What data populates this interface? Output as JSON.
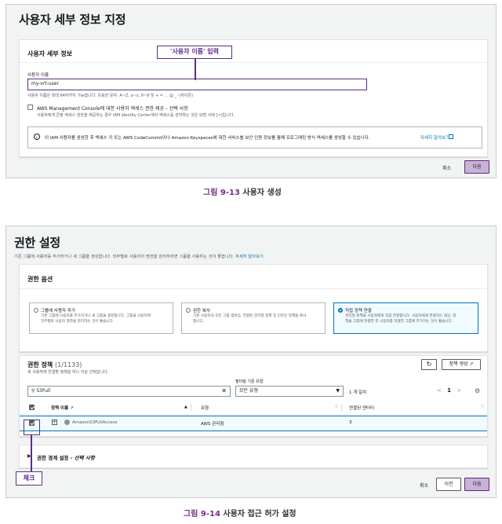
{
  "fig1": {
    "page_title": "사용자 세부 정보 지정",
    "section_title": "사용자 세부 정보",
    "callout": "'사용자 이름' 입력",
    "username_label": "사용자 이름",
    "username_value": "my-vrt-user",
    "username_hint": "사용자 이름은 최대 64자까지 가능합니다. 유효한 문자: A~Z, a~z, 0~9 및 + = , . @ _ -(하이픈)",
    "console_access_label": "AWS Management Console에 대한 사용자 액세스 권한 제공 – 선택 사항",
    "console_access_desc": "사용자에게 콘솔 액세스 권한을 제공하는 경우 IAM Identity Center에서 액세스를 관리하는 것은 모범 사례 [↗]입니다.",
    "info_text": "이 IAM 사용자를 생성한 후 액세스 키 또는 AWS CodeCommit이나 Amazon Keyspaces에 대한 서비스별 보안 인증 정보를 통해 프로그래밍 방식 액세스를 생성할 수 있습니다.",
    "info_link": "자세히 알아보기",
    "cancel": "취소",
    "next": "다음",
    "caption_num": "그림 9-13",
    "caption_text": "사용자 생성"
  },
  "fig2": {
    "page_title": "권한 설정",
    "page_desc": "기존 그룹에 사용자를 추가하거나 새 그룹을 생성합니다. 직무별로 사용자의 권한을 관리하려면 그룹을 사용하는 것이 좋습니다.",
    "page_desc_link": "자세히 알아보기",
    "options_title": "권한 옵션",
    "options": [
      {
        "title": "그룹에 사용자 추가",
        "desc": "기존 그룹에 사용자를 추가하거나 새 그룹을 생성합니다. 그룹을 사용하여 직무별로 사용자 권한을 관리하는 것이 좋습니다.",
        "selected": false
      },
      {
        "title": "권한 복사",
        "desc": "기존 사용자의 모든 그룹 멤버십, 연결된 관리형 정책 및 인라인 정책을 복사합니다.",
        "selected": false
      },
      {
        "title": "직접 정책 연결",
        "desc": "관리형 정책을 사용자에게 직접 연결합니다. 사용자에게 연결하는 대신, 정책을 그룹에 연결한 후 사용자를 적절한 그룹에 추가하는 것이 좋습니다.",
        "selected": true
      }
    ],
    "policies_title": "권한 정책",
    "policies_count": "(1/1133)",
    "policies_desc": "새 사용자에 연결할 정책을 하나 이상 선택합니다.",
    "refresh_icon": "refresh-icon",
    "create_policy": "정책 생성",
    "filter_label": "필터링 기준 유형",
    "search_value": "S3Full",
    "filter_value": "모든 유형",
    "match_count": "1 개 일치",
    "page_number": "1",
    "columns": [
      "정책 이름",
      "유형",
      "연결된 엔터티"
    ],
    "row": {
      "name": "AmazonS3FullAccess",
      "type": "AWS 관리형",
      "entities": "3"
    },
    "boundary_label": "권한 경계 설정 - ",
    "boundary_optional": "선택 사항",
    "check_callout": "체크",
    "cancel": "취소",
    "prev": "이전",
    "next": "다음",
    "caption_num": "그림 9-14",
    "caption_text": "사용자 접근 허가 설정"
  },
  "colors": {
    "accent": "#5b2d8a",
    "link": "#0073bb",
    "primary_button": "#c8b3d6"
  }
}
